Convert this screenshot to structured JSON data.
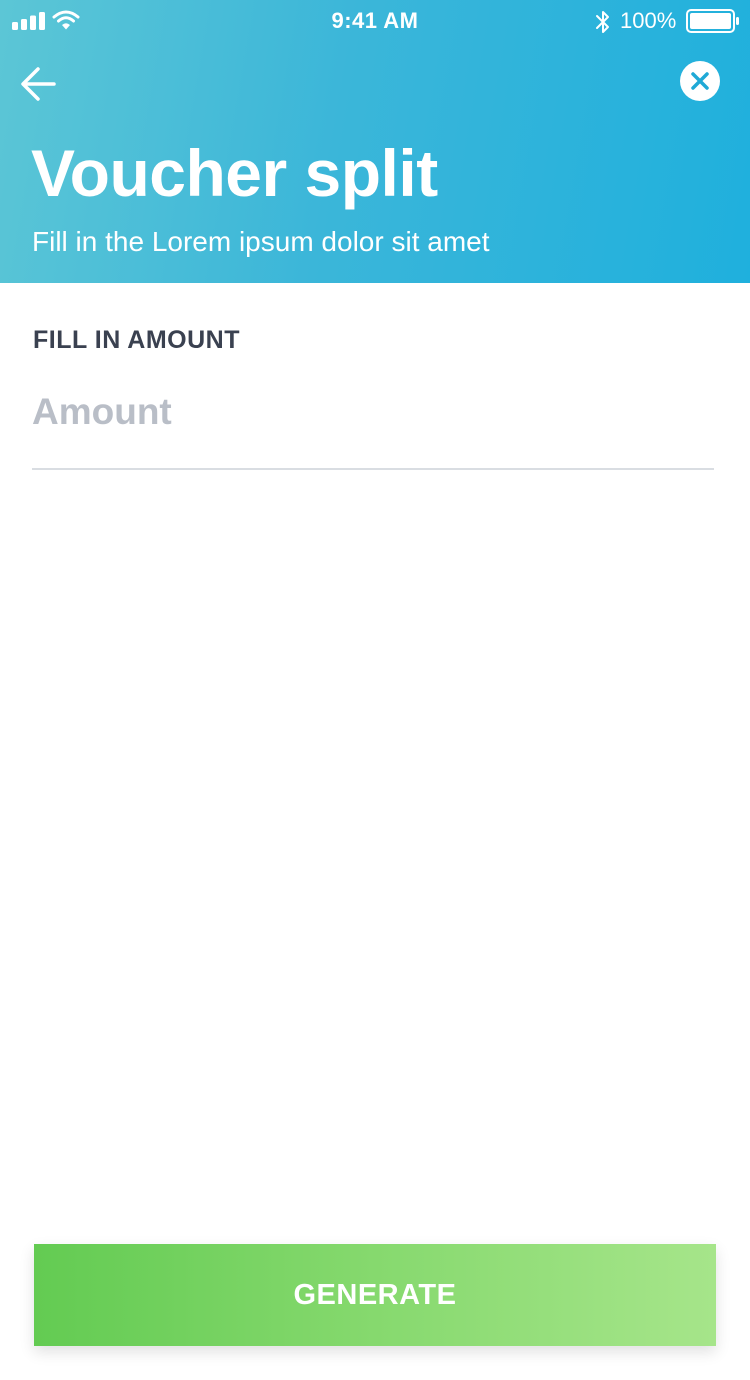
{
  "status_bar": {
    "time": "9:41 AM",
    "battery_percent": "100%",
    "battery_level": 1.0,
    "icons": [
      "signal-icon",
      "wifi-icon",
      "bluetooth-icon",
      "battery-icon"
    ]
  },
  "header": {
    "title": "Voucher split",
    "subtitle": "Fill in the Lorem ipsum dolor sit amet",
    "back_icon": "arrow-left-icon",
    "close_icon": "close-icon"
  },
  "form": {
    "label": "FILL IN AMOUNT",
    "amount_placeholder": "Amount",
    "amount_value": ""
  },
  "actions": {
    "generate_label": "GENERATE"
  },
  "colors": {
    "header_gradient": [
      "#5cc6d6",
      "#1fb0dd"
    ],
    "button_gradient": [
      "#63cb52",
      "#a6e58a"
    ],
    "label_text": "#3a4150",
    "placeholder_text": "#b9bec7",
    "close_icon": "#1fa9d6"
  }
}
